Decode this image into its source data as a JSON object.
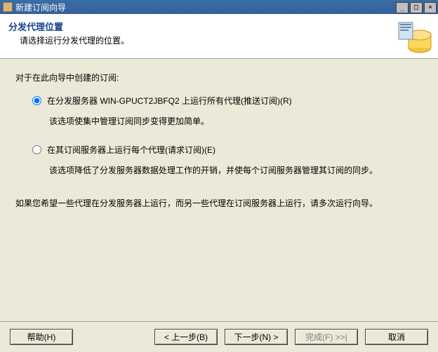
{
  "window": {
    "title": "新建订阅向导",
    "buttons": {
      "min": "_",
      "max": "□",
      "close": "×"
    }
  },
  "header": {
    "title": "分发代理位置",
    "subtitle": "请选择运行分发代理的位置。"
  },
  "content": {
    "intro": "对于在此向导中创建的订阅:",
    "option1": {
      "label_pre": "在分发服务器 ",
      "server": "WIN-GPUCT2JBFQ2",
      "label_post": " 上运行所有代理(推送订阅)(R)",
      "desc": "该选项使集中管理订阅同步变得更加简单。"
    },
    "option2": {
      "label": "在其订阅服务器上运行每个代理(请求订阅)(E)",
      "desc": "该选项降低了分发服务器数据处理工作的开销，并使每个订阅服务器管理其订阅的同步。"
    },
    "footer_note": "如果您希望一些代理在分发服务器上运行，而另一些代理在订阅服务器上运行，请多次运行向导。"
  },
  "buttons": {
    "help": "帮助(H)",
    "back": "< 上一步(B)",
    "next": "下一步(N) >",
    "finish": "完成(F) >>|",
    "cancel": "取消"
  }
}
